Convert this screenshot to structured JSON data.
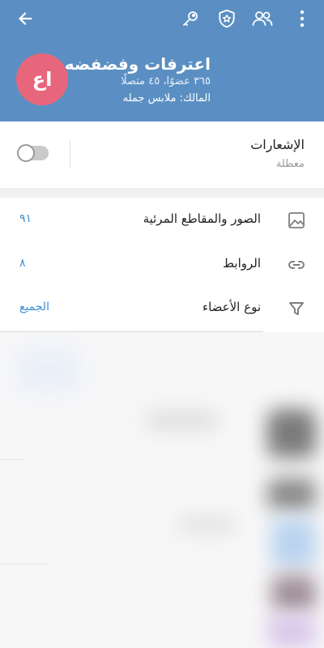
{
  "header": {
    "title": "اعترفات وفضفضه",
    "stats": "٣٦٥ عضوًا، ٤٥ متصلًا",
    "owner": "المالك: ملابس جمله",
    "avatar_initials": "اع",
    "background_color": "#5b8fc3",
    "avatar_color": "#e8667c",
    "icons": {
      "back": "arrow-left-icon",
      "key": "key-icon",
      "admin": "shield-star-icon",
      "members": "people-icon",
      "menu": "more-vertical-icon"
    }
  },
  "notifications": {
    "label": "الإشعارات",
    "status": "معطلة",
    "enabled": false
  },
  "shared_media": [
    {
      "label": "الصور والمقاطع المرئية",
      "count": "٩١",
      "icon": "image-icon"
    },
    {
      "label": "الروابط",
      "count": "٨",
      "icon": "link-icon"
    },
    {
      "label": "نوع الأعضاء",
      "count": "الجميع",
      "icon": "filter-icon"
    }
  ],
  "accent_color": "#3b8ed6"
}
